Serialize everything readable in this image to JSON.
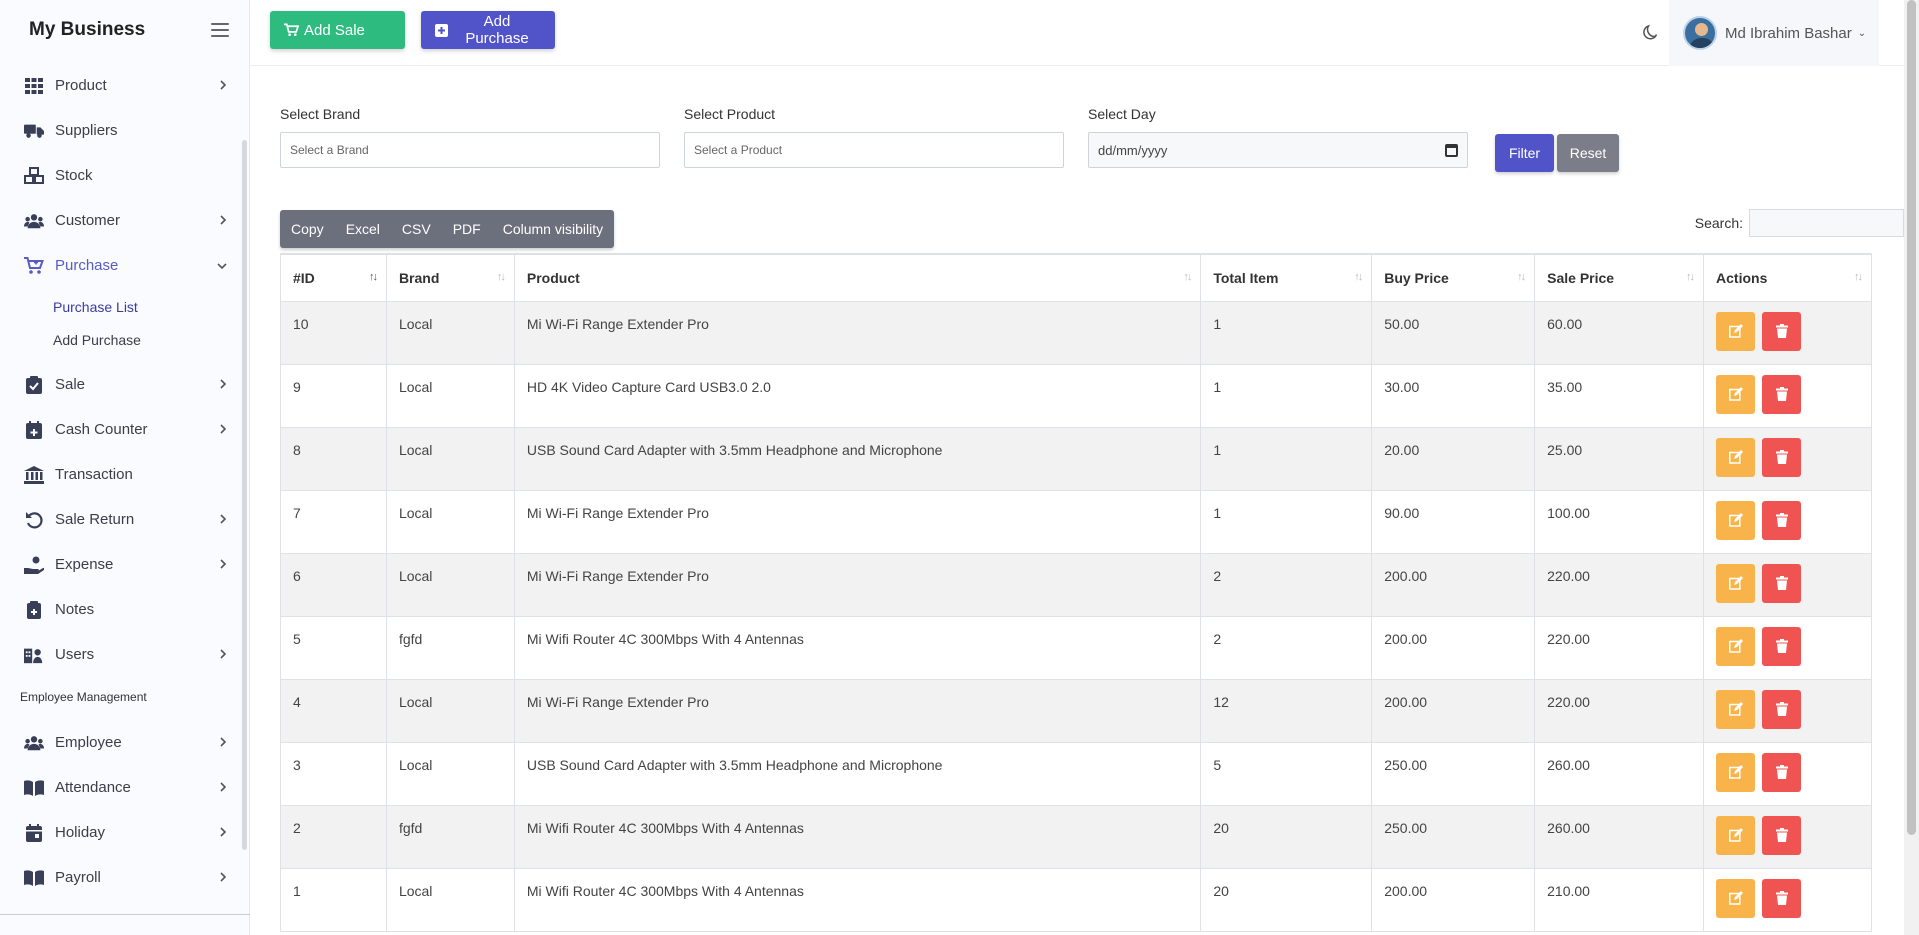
{
  "app": {
    "title": "My Business"
  },
  "sidebar": {
    "items": [
      {
        "label": "Product",
        "icon": "grid-icon",
        "has_children": true
      },
      {
        "label": "Suppliers",
        "icon": "truck-icon",
        "has_children": false
      },
      {
        "label": "Stock",
        "icon": "boxes-icon",
        "has_children": false
      },
      {
        "label": "Customer",
        "icon": "users-icon",
        "has_children": true
      },
      {
        "label": "Purchase",
        "icon": "cart-icon",
        "has_children": true,
        "expanded": true
      },
      {
        "label": "Sale",
        "icon": "clipboard-check-icon",
        "has_children": true
      },
      {
        "label": "Cash Counter",
        "icon": "calendar-plus-icon",
        "has_children": true
      },
      {
        "label": "Transaction",
        "icon": "bank-icon",
        "has_children": false
      },
      {
        "label": "Sale Return",
        "icon": "undo-icon",
        "has_children": true
      },
      {
        "label": "Expense",
        "icon": "hand-coin-icon",
        "has_children": true
      },
      {
        "label": "Notes",
        "icon": "notes-icon",
        "has_children": false
      },
      {
        "label": "Users",
        "icon": "users-building-icon",
        "has_children": true
      }
    ],
    "purchase_submenu": [
      "Purchase List",
      "Add Purchase"
    ],
    "section_label": "Employee Management",
    "employee_items": [
      {
        "label": "Employee",
        "icon": "users-icon"
      },
      {
        "label": "Attendance",
        "icon": "book-icon"
      },
      {
        "label": "Holiday",
        "icon": "calendar-icon"
      },
      {
        "label": "Payroll",
        "icon": "book-icon"
      }
    ]
  },
  "topbar": {
    "add_sale": "Add Sale",
    "add_purchase": "Add Purchase",
    "user_name": "Md Ibrahim Bashar"
  },
  "filters": {
    "brand_label": "Select Brand",
    "brand_placeholder": "Select a Brand",
    "product_label": "Select Product",
    "product_placeholder": "Select a Product",
    "day_label": "Select Day",
    "day_placeholder": "dd/mm/yyyy",
    "filter_button": "Filter",
    "reset_button": "Reset"
  },
  "export_buttons": [
    "Copy",
    "Excel",
    "CSV",
    "PDF",
    "Column visibility"
  ],
  "search_label": "Search:",
  "table": {
    "columns": [
      "#ID",
      "Brand",
      "Product",
      "Total Item",
      "Buy Price",
      "Sale Price",
      "Actions"
    ],
    "rows": [
      [
        "10",
        "Local",
        "Mi Wi-Fi Range Extender Pro",
        "1",
        "50.00",
        "60.00"
      ],
      [
        "9",
        "Local",
        "HD 4K Video Capture Card USB3.0 2.0",
        "1",
        "30.00",
        "35.00"
      ],
      [
        "8",
        "Local",
        "USB Sound Card Adapter with 3.5mm Headphone and Microphone",
        "1",
        "20.00",
        "25.00"
      ],
      [
        "7",
        "Local",
        "Mi Wi-Fi Range Extender Pro",
        "1",
        "90.00",
        "100.00"
      ],
      [
        "6",
        "Local",
        "Mi Wi-Fi Range Extender Pro",
        "2",
        "200.00",
        "220.00"
      ],
      [
        "5",
        "fgfd",
        "Mi Wifi Router 4C 300Mbps With 4 Antennas",
        "2",
        "200.00",
        "220.00"
      ],
      [
        "4",
        "Local",
        "Mi Wi-Fi Range Extender Pro",
        "12",
        "200.00",
        "220.00"
      ],
      [
        "3",
        "Local",
        "USB Sound Card Adapter with 3.5mm Headphone and Microphone",
        "5",
        "250.00",
        "260.00"
      ],
      [
        "2",
        "fgfd",
        "Mi Wifi Router 4C 300Mbps With 4 Antennas",
        "20",
        "250.00",
        "260.00"
      ],
      [
        "1",
        "Local",
        "Mi Wifi Router 4C 300Mbps With 4 Antennas",
        "20",
        "200.00",
        "210.00"
      ]
    ]
  },
  "colors": {
    "primary": "#5153c8",
    "success": "#2ebb7f",
    "warning": "#f8b34a",
    "danger": "#f05452",
    "secondary": "#7b7e88"
  }
}
